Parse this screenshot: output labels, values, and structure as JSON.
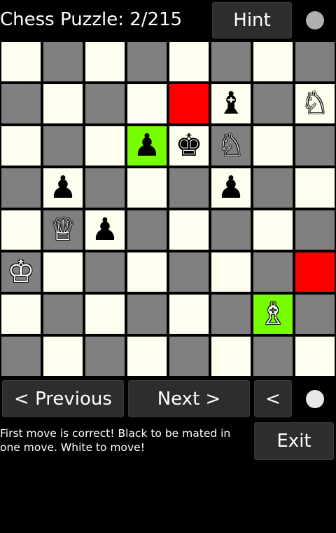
{
  "header": {
    "title": "Chess Puzzle: 2/215",
    "hint_label": "Hint"
  },
  "colors": {
    "light_square": "#fffff0",
    "dark_square": "#808080",
    "highlight_red": "#ff0000",
    "highlight_green": "#77ff00",
    "indicator": "#b0b0b0",
    "indicator_bottom": "#e8e8e8"
  },
  "board": {
    "files": [
      "a",
      "b",
      "c",
      "d",
      "e",
      "f",
      "g",
      "h"
    ],
    "highlights": [
      {
        "square": "e7",
        "color": "red"
      },
      {
        "square": "d6",
        "color": "green"
      },
      {
        "square": "h3",
        "color": "red"
      },
      {
        "square": "g2",
        "color": "green"
      }
    ],
    "pieces": [
      {
        "square": "f7",
        "piece": "bishop",
        "color": "black",
        "glyph": "♝"
      },
      {
        "square": "h7",
        "piece": "knight",
        "color": "white",
        "glyph": "♘"
      },
      {
        "square": "d6",
        "piece": "pawn",
        "color": "black",
        "glyph": "♟"
      },
      {
        "square": "e6",
        "piece": "king",
        "color": "black",
        "glyph": "♚"
      },
      {
        "square": "f6",
        "piece": "knight",
        "color": "white",
        "glyph": "♘"
      },
      {
        "square": "b5",
        "piece": "pawn",
        "color": "black",
        "glyph": "♟"
      },
      {
        "square": "f5",
        "piece": "pawn",
        "color": "black",
        "glyph": "♟"
      },
      {
        "square": "b4",
        "piece": "queen",
        "color": "white",
        "glyph": "♕"
      },
      {
        "square": "c4",
        "piece": "pawn",
        "color": "black",
        "glyph": "♟"
      },
      {
        "square": "a3",
        "piece": "king",
        "color": "white",
        "glyph": "♔"
      },
      {
        "square": "g2",
        "piece": "bishop",
        "color": "white",
        "glyph": "♗"
      }
    ]
  },
  "controls": {
    "previous_label": "< Previous",
    "next_label": "Next >",
    "back_label": "<",
    "exit_label": "Exit"
  },
  "status": {
    "message": "First move is correct! Black to be mated in one move. White to move!"
  }
}
